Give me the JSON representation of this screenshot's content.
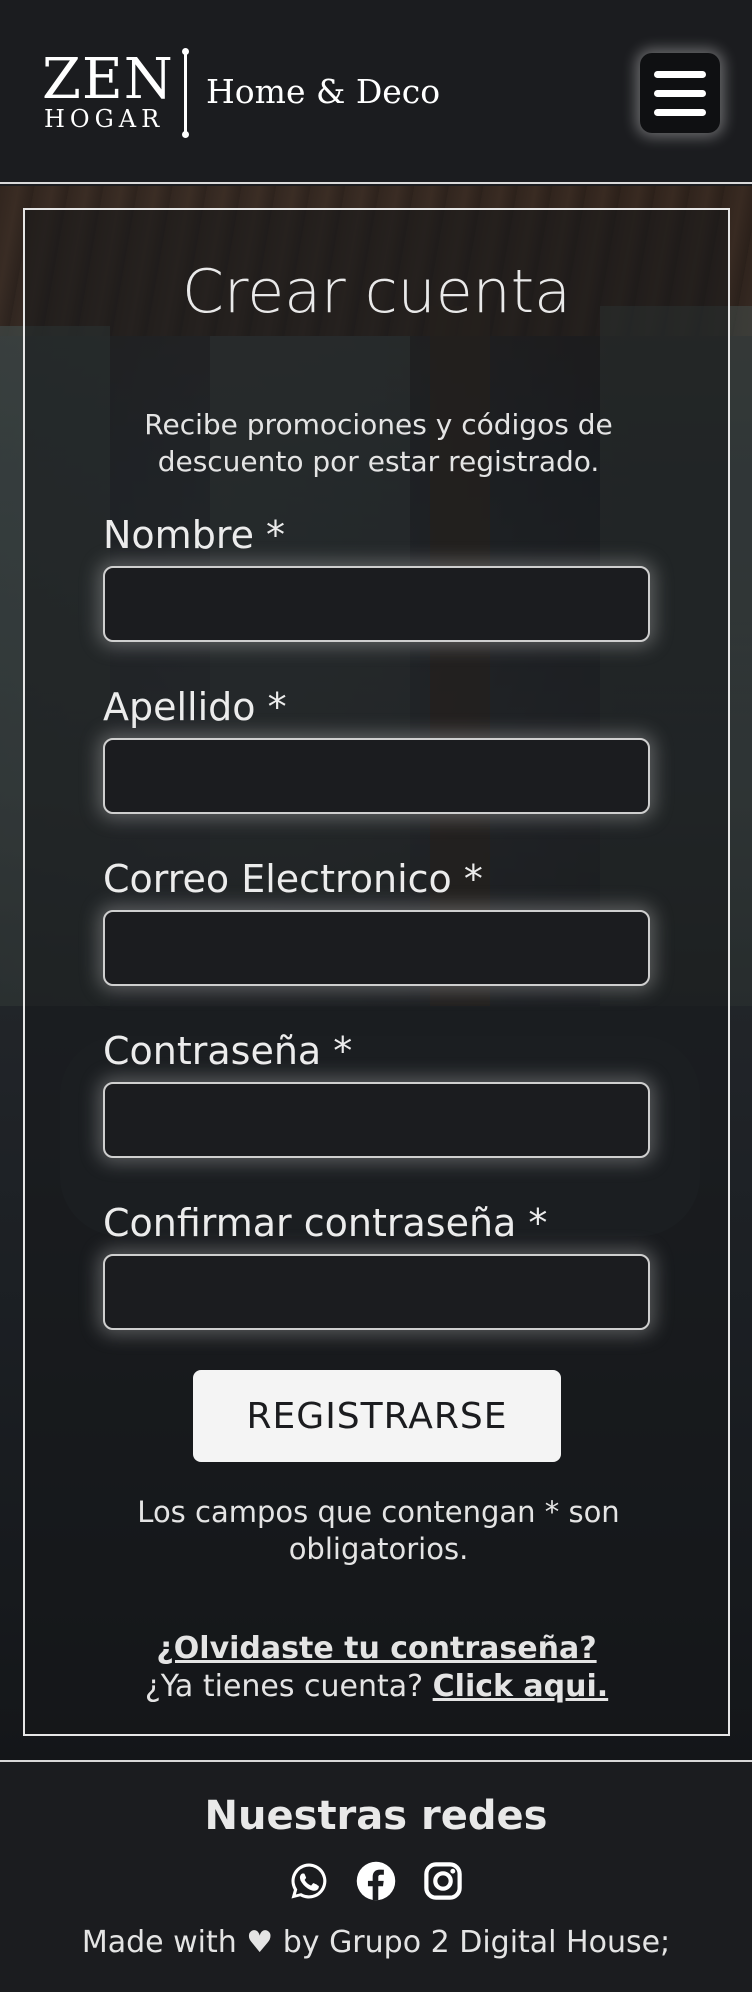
{
  "header": {
    "logo_main": "ZEN",
    "logo_sub": "HOGAR",
    "tagline": "Home & Deco",
    "menu_icon": "hamburger-menu-icon"
  },
  "form": {
    "title": "Crear cuenta",
    "subtitle": "Recibe promociones y códigos de descuento por estar registrado.",
    "fields": [
      {
        "label": "Nombre *",
        "value": "",
        "placeholder": ""
      },
      {
        "label": "Apellido *",
        "value": "",
        "placeholder": ""
      },
      {
        "label": "Correo Electronico *",
        "value": "",
        "placeholder": ""
      },
      {
        "label": "Contraseña *",
        "value": "",
        "placeholder": ""
      },
      {
        "label": "Confirmar contraseña *",
        "value": "",
        "placeholder": ""
      }
    ],
    "submit_label": "REGISTRARSE",
    "required_note": "Los campos que contengan * son obligatorios.",
    "forgot_password": "¿Olvidaste tu contraseña?",
    "have_account_text": "¿Ya tienes cuenta?",
    "login_link": "Click aqui."
  },
  "footer": {
    "title": "Nuestras redes",
    "social_icons": [
      "whatsapp-icon",
      "facebook-icon",
      "instagram-icon"
    ],
    "credits": "Made with ♥ by Grupo 2 Digital House;"
  },
  "colors": {
    "background": "#1b1c1f",
    "text": "#e4e4e4",
    "button": "#f4f4f4"
  }
}
